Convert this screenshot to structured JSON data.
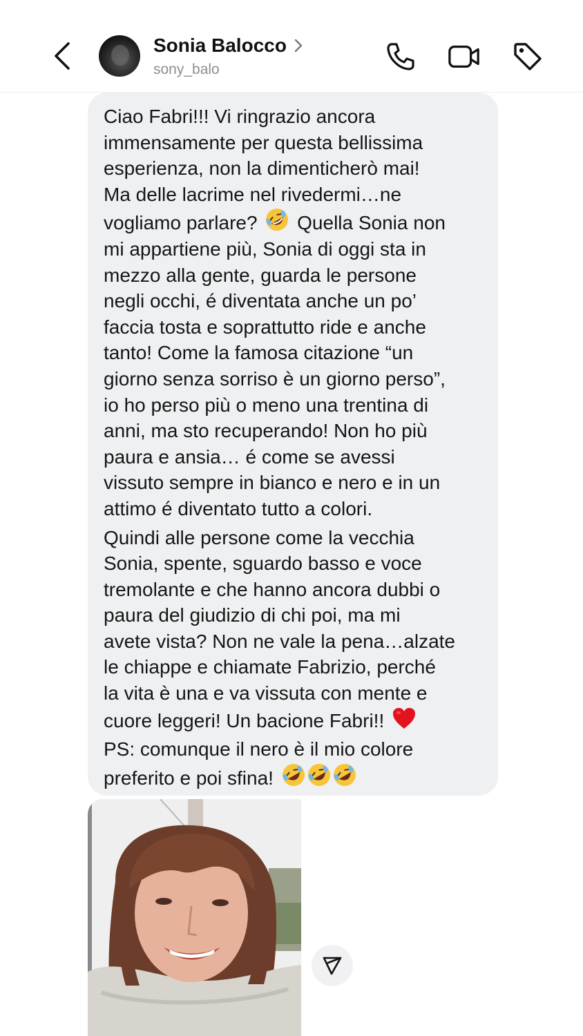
{
  "header": {
    "contact_name": "Sonia Balocco",
    "contact_handle": "sony_balo",
    "icons": [
      "back-arrow-icon",
      "chevron-right-icon",
      "phone-icon",
      "video-camera-icon",
      "tag-icon"
    ]
  },
  "message": {
    "lines": [
      "Ciao Fabri!!! Vi ringrazio ancora",
      "immensamente per questa bellissima",
      "esperienza, non la dimenticherò mai!",
      "Ma delle lacrime nel rivedermi…ne",
      "vogliamo parlare?",
      "Quella Sonia non",
      "mi appartiene più, Sonia di oggi sta in",
      "mezzo alla gente, guarda le persone",
      "negli occhi, é diventata anche un po’",
      "faccia tosta e soprattutto ride e anche",
      "tanto! Come la famosa citazione “un",
      "giorno senza sorriso è un giorno perso”,",
      "io ho perso più o meno una trentina di",
      "anni, ma sto recuperando! Non ho più",
      "paura e ansia… é come se avessi",
      "vissuto sempre in bianco e nero e in un",
      "attimo é diventato tutto a colori.",
      "Quindi alle persone come la vecchia",
      "Sonia, spente, sguardo basso e voce",
      "tremolante e che hanno ancora dubbi o",
      "paura del giudizio di chi poi, ma mi",
      "avete vista? Non ne vale la pena…alzate",
      "le chiappe e chiamate Fabrizio, perché",
      "la vita è una e va vissuta con mente e",
      "cuore leggeri! Un bacione Fabri!!",
      "PS: comunque il nero è il mio colore",
      "preferito e poi sfina!"
    ],
    "emojis": [
      "rolling-on-floor-laughing",
      "red-heart"
    ]
  },
  "colors": {
    "bubble": "#eff0f2",
    "text": "#151515",
    "secondary_text": "#8e8e8e",
    "emoji_yellow": "#f7c53a",
    "heart_red": "#e2131e"
  }
}
